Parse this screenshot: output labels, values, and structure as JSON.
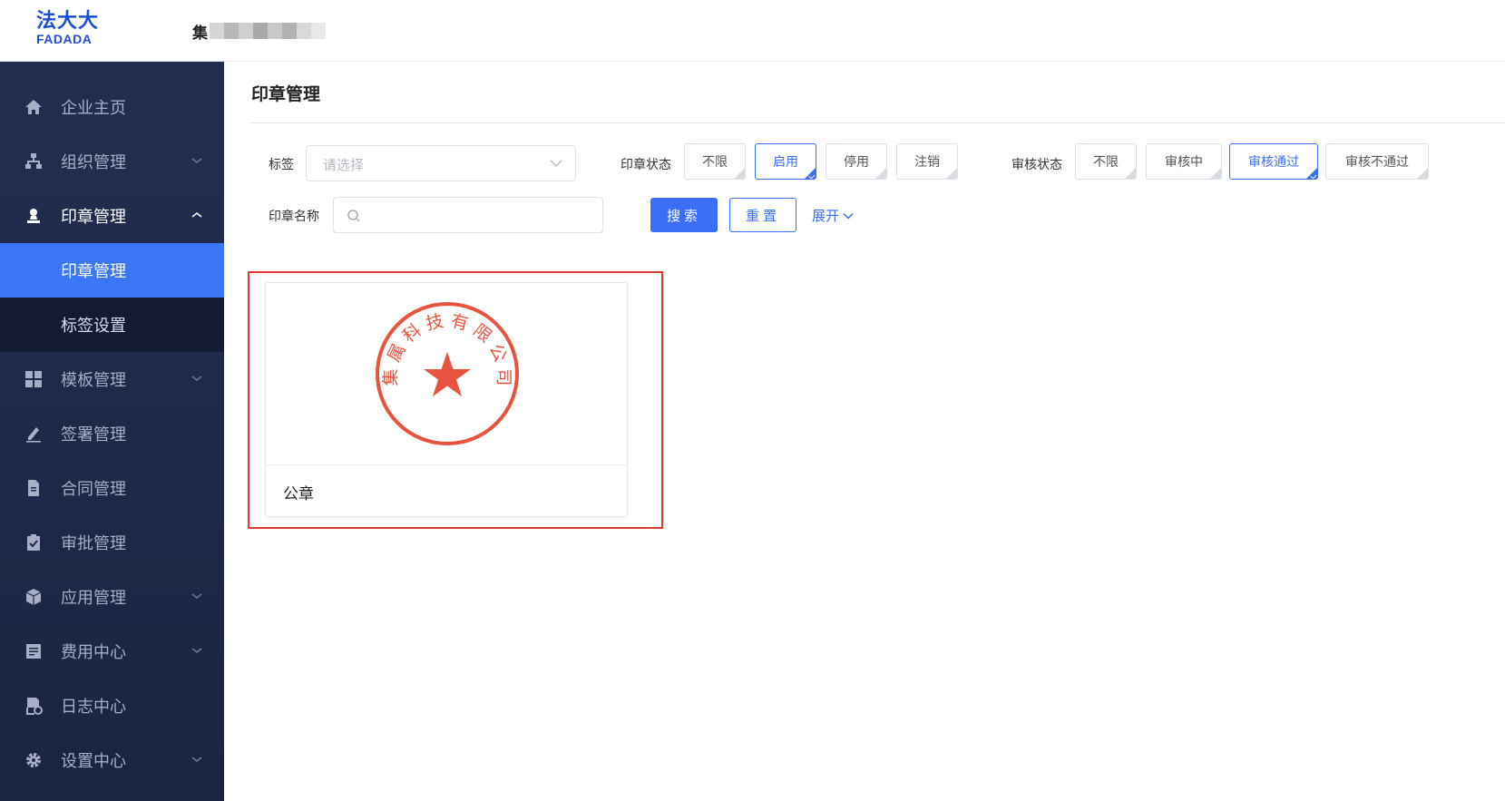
{
  "header": {
    "logo_cn": "法大大",
    "logo_en": "FADADA",
    "company_first_char": "集"
  },
  "sidebar": {
    "items": [
      {
        "label": "企业主页",
        "icon": "home-icon"
      },
      {
        "label": "组织管理",
        "icon": "org-icon",
        "has_chevron": true
      },
      {
        "label": "印章管理",
        "icon": "seal-user-icon",
        "expanded": true
      },
      {
        "label": "印章管理",
        "sub": true,
        "active": true
      },
      {
        "label": "标签设置",
        "sub": true
      },
      {
        "label": "模板管理",
        "icon": "grid-icon",
        "has_chevron": true
      },
      {
        "label": "签署管理",
        "icon": "pen-icon"
      },
      {
        "label": "合同管理",
        "icon": "document-icon"
      },
      {
        "label": "审批管理",
        "icon": "clipboard-check-icon"
      },
      {
        "label": "应用管理",
        "icon": "cube-icon",
        "has_chevron": true
      },
      {
        "label": "费用中心",
        "icon": "receipt-icon",
        "has_chevron": true
      },
      {
        "label": "日志中心",
        "icon": "log-icon"
      },
      {
        "label": "设置中心",
        "icon": "gear-icon",
        "has_chevron": true
      }
    ]
  },
  "main": {
    "title": "印章管理",
    "filters": {
      "tag_label": "标签",
      "tag_placeholder": "请选择",
      "seal_status_label": "印章状态",
      "seal_status_options": [
        "不限",
        "启用",
        "停用",
        "注销"
      ],
      "seal_status_selected": "启用",
      "review_status_label": "审核状态",
      "review_status_options": [
        "不限",
        "审核中",
        "审核通过",
        "审核不通过"
      ],
      "review_status_selected": "审核通过",
      "name_label": "印章名称",
      "name_value": "",
      "search_label": "搜索",
      "reset_label": "重置",
      "expand_label": "展开"
    },
    "cards": [
      {
        "title": "公章",
        "seal_text": "集 属 科 技 有 限 公 司",
        "seal_color": "#e8533f"
      }
    ]
  },
  "colors": {
    "primary": "#3b6df5",
    "sidebar_bg": "#1f2846",
    "highlight": "#e53935"
  }
}
